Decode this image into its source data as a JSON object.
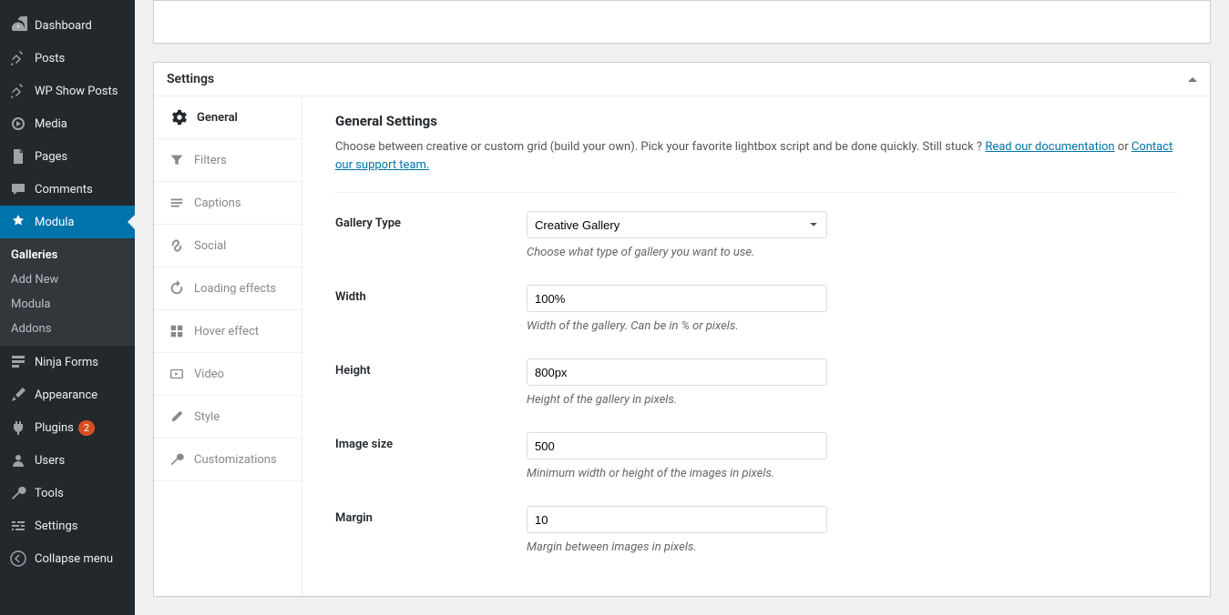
{
  "sidebar": {
    "items": [
      {
        "label": "Dashboard",
        "icon": "dashboard"
      },
      {
        "label": "Posts",
        "icon": "pin"
      },
      {
        "label": "WP Show Posts",
        "icon": "pin"
      },
      {
        "label": "Media",
        "icon": "media"
      },
      {
        "label": "Pages",
        "icon": "page"
      },
      {
        "label": "Comments",
        "icon": "comment"
      },
      {
        "label": "Modula",
        "icon": "modula",
        "active": true
      },
      {
        "label": "Ninja Forms",
        "icon": "form"
      },
      {
        "label": "Appearance",
        "icon": "brush"
      },
      {
        "label": "Plugins",
        "icon": "plugin",
        "badge": "2"
      },
      {
        "label": "Users",
        "icon": "user"
      },
      {
        "label": "Tools",
        "icon": "wrench"
      },
      {
        "label": "Settings",
        "icon": "sliders"
      },
      {
        "label": "Collapse menu",
        "icon": "collapse"
      }
    ],
    "submenu": [
      {
        "label": "Galleries",
        "current": true
      },
      {
        "label": "Add New"
      },
      {
        "label": "Modula"
      },
      {
        "label": "Addons"
      }
    ]
  },
  "settings_panel": {
    "title": "Settings",
    "tabs": [
      {
        "label": "General",
        "icon": "gear",
        "active": true
      },
      {
        "label": "Filters",
        "icon": "funnel"
      },
      {
        "label": "Captions",
        "icon": "lines"
      },
      {
        "label": "Social",
        "icon": "link"
      },
      {
        "label": "Loading effects",
        "icon": "reload"
      },
      {
        "label": "Hover effect",
        "icon": "grid"
      },
      {
        "label": "Video",
        "icon": "play"
      },
      {
        "label": "Style",
        "icon": "pencil"
      },
      {
        "label": "Customizations",
        "icon": "wrench2"
      }
    ],
    "content": {
      "heading": "General Settings",
      "description_part1": "Choose between creative or custom grid (build your own). Pick your favorite lightbox script and be done quickly. Still stuck ? ",
      "link_docs": "Read our documentation",
      "description_or": " or ",
      "link_support": "Contact our support team.",
      "fields": {
        "gallery_type": {
          "label": "Gallery Type",
          "value": "Creative Gallery",
          "helper": "Choose what type of gallery you want to use."
        },
        "width": {
          "label": "Width",
          "value": "100%",
          "helper": "Width of the gallery. Can be in % or pixels."
        },
        "height": {
          "label": "Height",
          "value": "800px",
          "helper": "Height of the gallery in pixels."
        },
        "image_size": {
          "label": "Image size",
          "value": "500",
          "helper": "Minimum width or height of the images in pixels."
        },
        "margin": {
          "label": "Margin",
          "value": "10",
          "helper": "Margin between images in pixels."
        }
      }
    }
  }
}
